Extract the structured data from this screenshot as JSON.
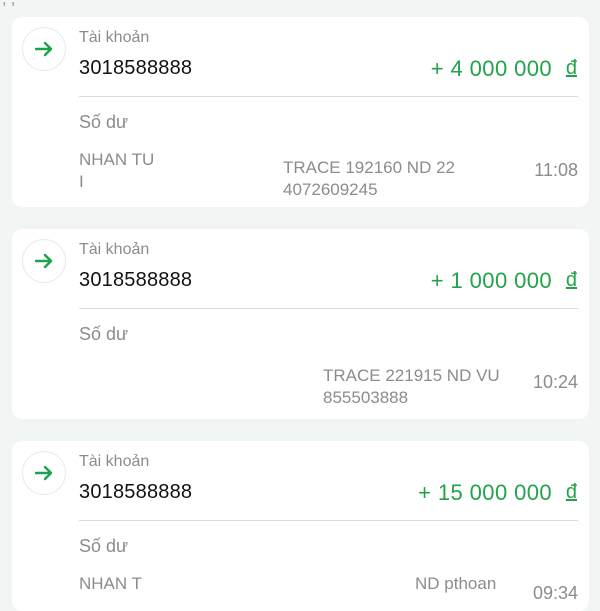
{
  "top_fragment": ", ,",
  "transactions": [
    {
      "direction_icon": "arrow-right-icon",
      "account_label": "Tài khoản",
      "account_number": "3018588888",
      "amount": "+ 4 000 000",
      "currency": "đ",
      "balance_label": "Số dư",
      "description_left": "NHAN TU\nI",
      "description_middle": "TRACE 192160 ND 22\n4072609245",
      "time": "11:08"
    },
    {
      "direction_icon": "arrow-right-icon",
      "account_label": "Tài khoản",
      "account_number": "3018588888",
      "amount": "+ 1 000 000",
      "currency": "đ",
      "balance_label": "Số dư",
      "description_left": "",
      "description_middle": "TRACE 221915 ND VU\n855503888",
      "time": "10:24"
    },
    {
      "direction_icon": "arrow-right-icon",
      "account_label": "Tài khoản",
      "account_number": "3018588888",
      "amount": "+ 15 000 000",
      "currency": "đ",
      "balance_label": "Số dư",
      "description_left": "NHAN T",
      "description_middle": "ND pthoan",
      "time": "09:34"
    }
  ],
  "colors": {
    "amount_green": "#22a34a",
    "arrow_green": "#1aa34a",
    "label_gray": "#8c8c8c",
    "background": "#f1f5f4"
  }
}
